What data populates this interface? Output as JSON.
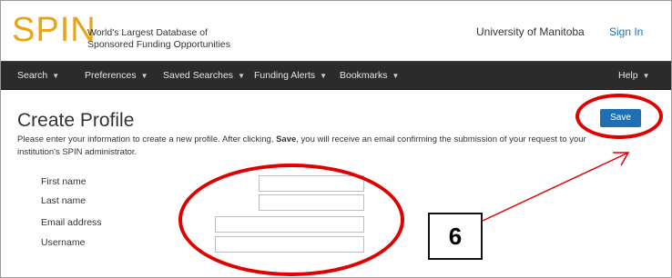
{
  "header": {
    "logo": "SPIN",
    "tagline_line1": "World's Largest Database of",
    "tagline_line2": "Sponsored Funding Opportunities",
    "institution": "University of Manitoba",
    "sign_in": "Sign In"
  },
  "nav": {
    "items": [
      {
        "label": "Search"
      },
      {
        "label": "Preferences"
      },
      {
        "label": "Saved Searches"
      },
      {
        "label": "Funding Alerts"
      },
      {
        "label": "Bookmarks"
      }
    ],
    "help": "Help"
  },
  "main": {
    "title": "Create Profile",
    "instructions_before": "Please enter your information to create a new profile. After clicking, ",
    "instructions_bold": "Save",
    "instructions_after": ", you will receive an email confirming the submission of your request to your institution's SPIN administrator.",
    "save_label": "Save"
  },
  "form": {
    "fields": [
      {
        "label": "First name",
        "value": ""
      },
      {
        "label": "Last name",
        "value": ""
      },
      {
        "label": "Email address",
        "value": ""
      },
      {
        "label": "Username",
        "value": ""
      }
    ]
  },
  "annotation": {
    "step_number": "6",
    "color": "#e00000"
  }
}
